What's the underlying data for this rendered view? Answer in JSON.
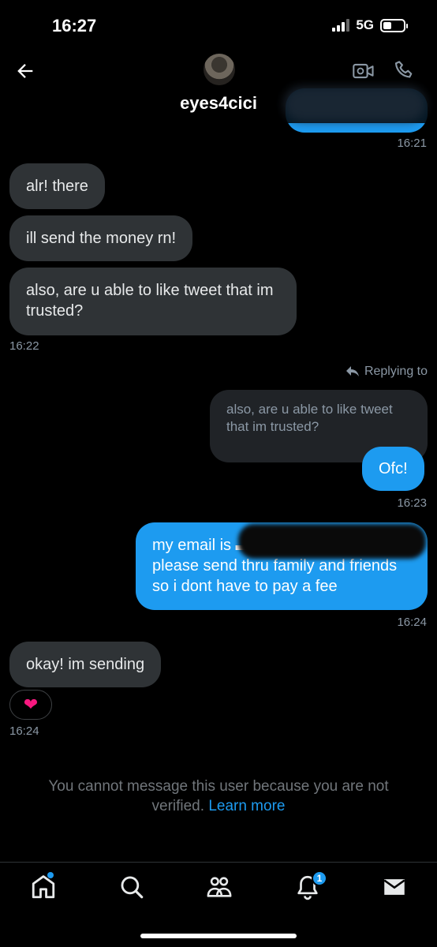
{
  "status_bar": {
    "time": "16:27",
    "network": "5G"
  },
  "header": {
    "username": "eyes4cici"
  },
  "messages": [
    {
      "direction": "out",
      "text": "",
      "time": "16:21"
    },
    {
      "direction": "in",
      "text": "alr! there"
    },
    {
      "direction": "in",
      "text": "ill send the money rn!"
    },
    {
      "direction": "in",
      "text": "also, are u able to like tweet that im trusted?",
      "time": "16:22"
    },
    {
      "direction": "out",
      "reply_label": "Replying to",
      "quoted_text": "also, are u able to like tweet that im trusted?",
      "text": "Ofc!",
      "time": "16:23"
    },
    {
      "direction": "out",
      "text": "my email is ▬▬▬▬▬▬▬▬▬▬ please send thru family and friends so i dont have to pay a fee",
      "time": "16:24"
    },
    {
      "direction": "in",
      "text": "okay! im sending",
      "reaction": "❤",
      "time": "16:24"
    }
  ],
  "notice": {
    "text": "You cannot message this user because you are not verified.",
    "link": "Learn more"
  },
  "nav": {
    "notification_count": "1"
  },
  "colors": {
    "accent": "#1d9bf0",
    "incoming_bubble": "#2f3336",
    "background": "#000000"
  }
}
